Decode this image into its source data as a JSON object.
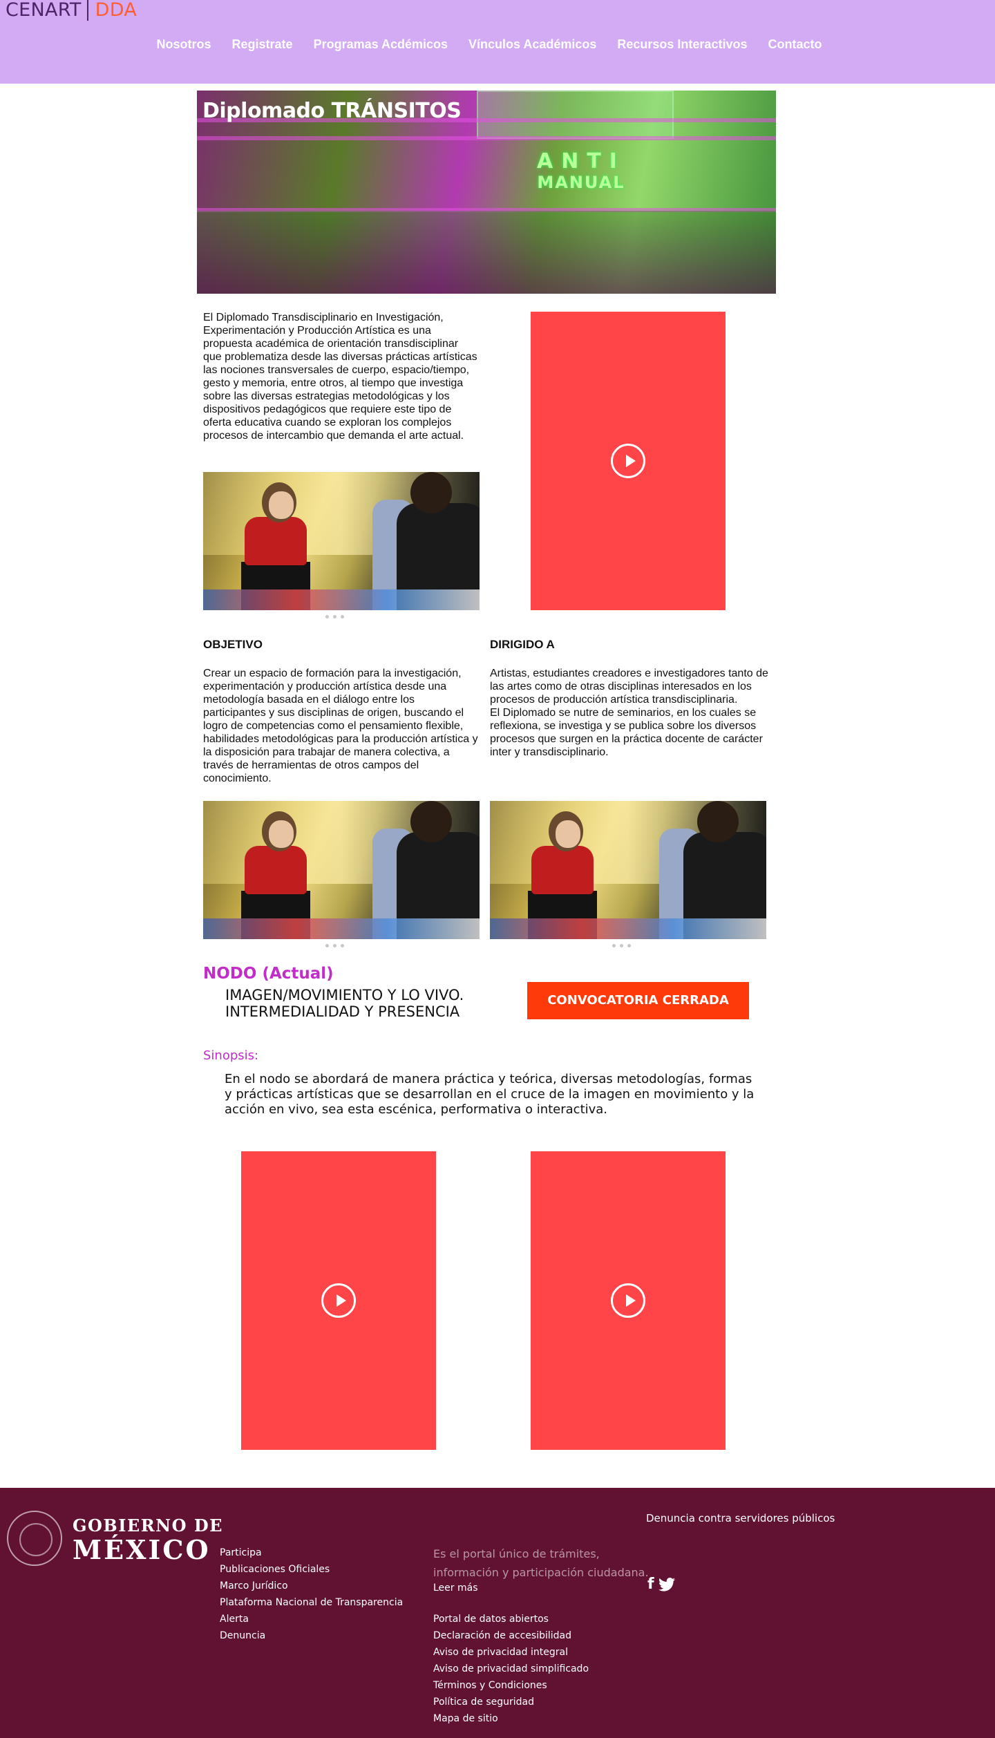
{
  "header": {
    "logo": {
      "part1": "CENART",
      "part2": "DDA"
    },
    "nav": [
      {
        "label": "Nosotros"
      },
      {
        "label": "Registrate"
      },
      {
        "label": "Programas Acdémicos"
      },
      {
        "label": "Vínculos Académicos"
      },
      {
        "label": "Recursos Interactivos"
      },
      {
        "label": "Contacto"
      }
    ]
  },
  "hero": {
    "title_part1": "Diplomado ",
    "title_part2": "TRÁNSITOS",
    "sign_line1": "ANTI",
    "sign_line2": "MANUAL"
  },
  "intro": {
    "text": "El Diplomado Transdisciplinario en Investigación, Experimentación y Producción Artística es una propuesta académica de orientación transdisciplinar que problematiza desde las diversas prácticas artísticas las nociones transversales de cuerpo, espacio/tiempo, gesto y memoria, entre otros, al tiempo que investiga sobre las diversas estrategias metodológicas y los dispositivos pedagógicos que requiere este tipo de oferta educativa cuando se exploran los complejos procesos de intercambio que demanda el arte actual."
  },
  "objetivo": {
    "heading": "OBJETIVO",
    "text": "Crear un espacio de formación para la investigación, experimentación y producción artística desde una metodología basada en el diálogo entre los participantes y sus disciplinas de origen, buscando el logro de competencias como el pensamiento flexible, habilidades metodológicas para la producción artística y la disposición para trabajar de manera colectiva, a través de herramientas de otros campos del conocimiento."
  },
  "dirigido": {
    "heading": "DIRIGIDO A",
    "text1": "Artistas, estudiantes creadores e investigadores tanto de las artes como de otras disciplinas interesados en los procesos de producción artística transdisciplinaria.",
    "text2": "El Diplomado se nutre de seminarios, en los cuales se reflexiona, se investiga y se publica sobre los diversos procesos que surgen en la práctica docente de carácter inter y transdisciplinario."
  },
  "nodo": {
    "heading_strong": "NODO",
    "heading_rest": " (Actual)",
    "title_line1": "IMAGEN/MOVIMIENTO Y LO VIVO.",
    "title_line2": "INTERMEDIALIDAD Y PRESENCIA",
    "button_label": "CONVOCATORIA CERRADA"
  },
  "sinopsis": {
    "label": "Sinopsis:",
    "text": "En el nodo se abordará de manera práctica y teórica, diversas metodologías, formas y prácticas artísticas que se desarrollan en el cruce de la imagen en movimiento y la acción en vivo, sea esta escénica, performativa o interactiva."
  },
  "colors": {
    "header_bg": "#d3aaf4",
    "accent_magenta": "#c12dc9",
    "video_red": "#ff4548",
    "button_orange": "#ff3a0a",
    "footer_bg": "#611232"
  },
  "footer": {
    "gob_line1": "GOBIERNO DE",
    "gob_line2": "MÉXICO",
    "col1": [
      {
        "label": "Participa"
      },
      {
        "label": "Publicaciones Oficiales"
      },
      {
        "label": "Marco Jurídico"
      },
      {
        "label": "Plataforma Nacional de Transparencia"
      },
      {
        "label": "Alerta"
      },
      {
        "label": "Denuncia"
      }
    ],
    "portal_desc": "Es el portal único de trámites, información y participación ciudadana.",
    "leer_mas": "Leer más",
    "col2": [
      {
        "label": "Portal de datos abiertos"
      },
      {
        "label": "Declaración de accesibilidad"
      },
      {
        "label": "Aviso de privacidad integral"
      },
      {
        "label": "Aviso de privacidad simplificado"
      },
      {
        "label": "Términos y Condiciones"
      },
      {
        "label": "Política de seguridad"
      },
      {
        "label": "Mapa de sitio"
      }
    ],
    "denuncia_servidores": "Denuncia contra servidores públicos",
    "social_icons": [
      "facebook-icon",
      "twitter-icon"
    ]
  }
}
